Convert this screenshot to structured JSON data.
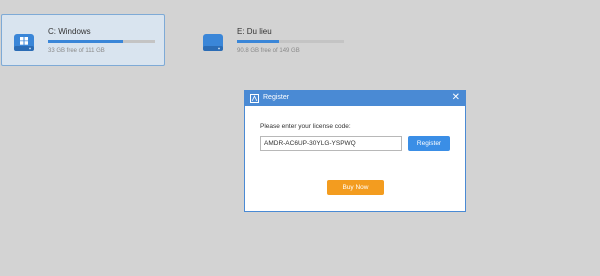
{
  "drives": [
    {
      "name": "C: Windows",
      "free_text": "33 GB free of 111 GB",
      "used_fraction": 0.7,
      "icon": "windows-drive-icon"
    },
    {
      "name": "E: Du lieu",
      "free_text": "90.8 GB free of 149 GB",
      "used_fraction": 0.39,
      "icon": "hard-drive-icon"
    }
  ],
  "dialog": {
    "title": "Register",
    "close_glyph": "✕",
    "prompt": "Please enter your license code:",
    "license_code": "AMDR-AC6UP-30YLG-YSPWQ",
    "register_label": "Register",
    "buy_label": "Buy Now"
  },
  "colors": {
    "background": "#d3d3d3",
    "accent": "#3a86d8",
    "title_bar": "#4a8ad4",
    "buy_button": "#f39c1f"
  }
}
